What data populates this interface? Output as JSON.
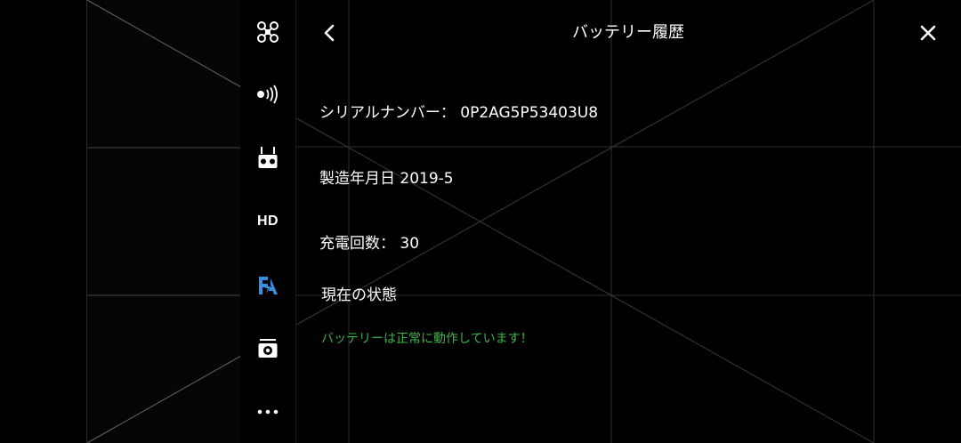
{
  "header": {
    "title": "バッテリー履歴"
  },
  "sidebar": {
    "items": [
      {
        "icon": "drone-icon"
      },
      {
        "icon": "signal-icon"
      },
      {
        "icon": "remote-controller-icon"
      },
      {
        "icon": "hd-icon",
        "label": "HD"
      },
      {
        "icon": "battery-flash-icon",
        "active": true
      },
      {
        "icon": "camera-icon"
      },
      {
        "icon": "more-icon"
      }
    ],
    "active_color": "#3b8fe0"
  },
  "battery": {
    "serial_label": "シリアルナンバー：",
    "serial_value": "0P2AG5P53403U8",
    "manufacture_label": "製造年月日",
    "manufacture_value": "2019-5",
    "charge_label": "充電回数：",
    "charge_value": "30",
    "status_heading": "現在の状態",
    "status_text": "バッテリーは正常に動作しています！",
    "status_color": "#3db34a"
  }
}
